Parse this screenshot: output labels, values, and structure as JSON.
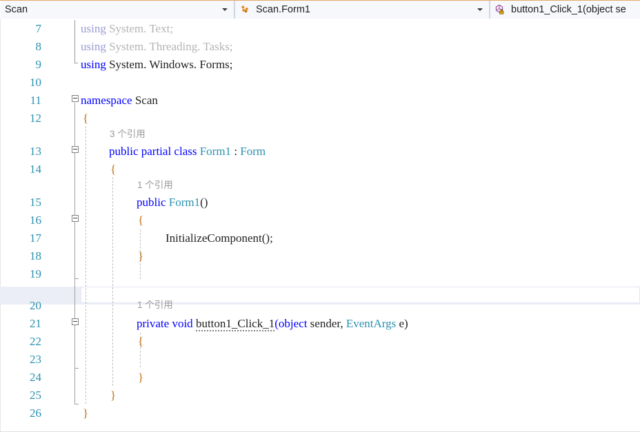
{
  "navbar": {
    "project": {
      "label": "Scan",
      "icon": "chevron-down-icon"
    },
    "type": {
      "label": "Scan.Form1",
      "icon": "class-icon"
    },
    "member": {
      "label": "button1_Click_1(object se",
      "icon": "method-private-icon"
    }
  },
  "editor": {
    "line_numbers": [
      "7",
      "8",
      "9",
      "10",
      "11",
      "12",
      "13",
      "14",
      "15",
      "16",
      "17",
      "18",
      "19",
      "20",
      "21",
      "22",
      "23",
      "24",
      "25",
      "26"
    ],
    "current_line": "22",
    "codelens": [
      {
        "text": "3 个引用"
      },
      {
        "text": "1 个引用"
      },
      {
        "text": "1 个引用"
      }
    ],
    "code": {
      "l7": {
        "kw": "using",
        "rest": " System. Text;"
      },
      "l8": {
        "kw": "using",
        "rest": " System. Threading. Tasks;"
      },
      "l9": {
        "kw": "using",
        "rest": " System. Windows. Forms;"
      },
      "l11": {
        "kw": "namespace",
        "name": " Scan"
      },
      "l12": {
        "brace": "{"
      },
      "l13": {
        "kw1": "public",
        "kw2": "partial",
        "kw3": "class",
        "type1": "Form1",
        "colon": ":",
        "type2": "Form"
      },
      "l14": {
        "brace": "{"
      },
      "l15": {
        "kw": "public",
        "type": "Form1",
        "parens": "()"
      },
      "l16": {
        "brace": "{"
      },
      "l17": {
        "call": "InitializeComponent",
        "tail": "();"
      },
      "l18": {
        "brace": "}"
      },
      "l20": {
        "kw1": "private",
        "kw2": "void",
        "method": "button1_Click_1",
        "p1": "(object",
        "p2": "sender,",
        "type": "EventArgs",
        "p3": "e)"
      },
      "l21": {
        "brace": "{"
      },
      "l23": {
        "brace": "}"
      },
      "l24": {
        "brace": "}"
      },
      "l25": {
        "brace": "}"
      }
    }
  },
  "colors": {
    "keyword": "#0000ff",
    "type": "#2b91af",
    "brace": "#c07010",
    "linenumber": "#2b91af",
    "codelens": "#9a9a9a",
    "navbar_bg": "#eef1f8",
    "navbar_accent": "#e3a96b",
    "current_line_border": "#e4e6f1"
  }
}
